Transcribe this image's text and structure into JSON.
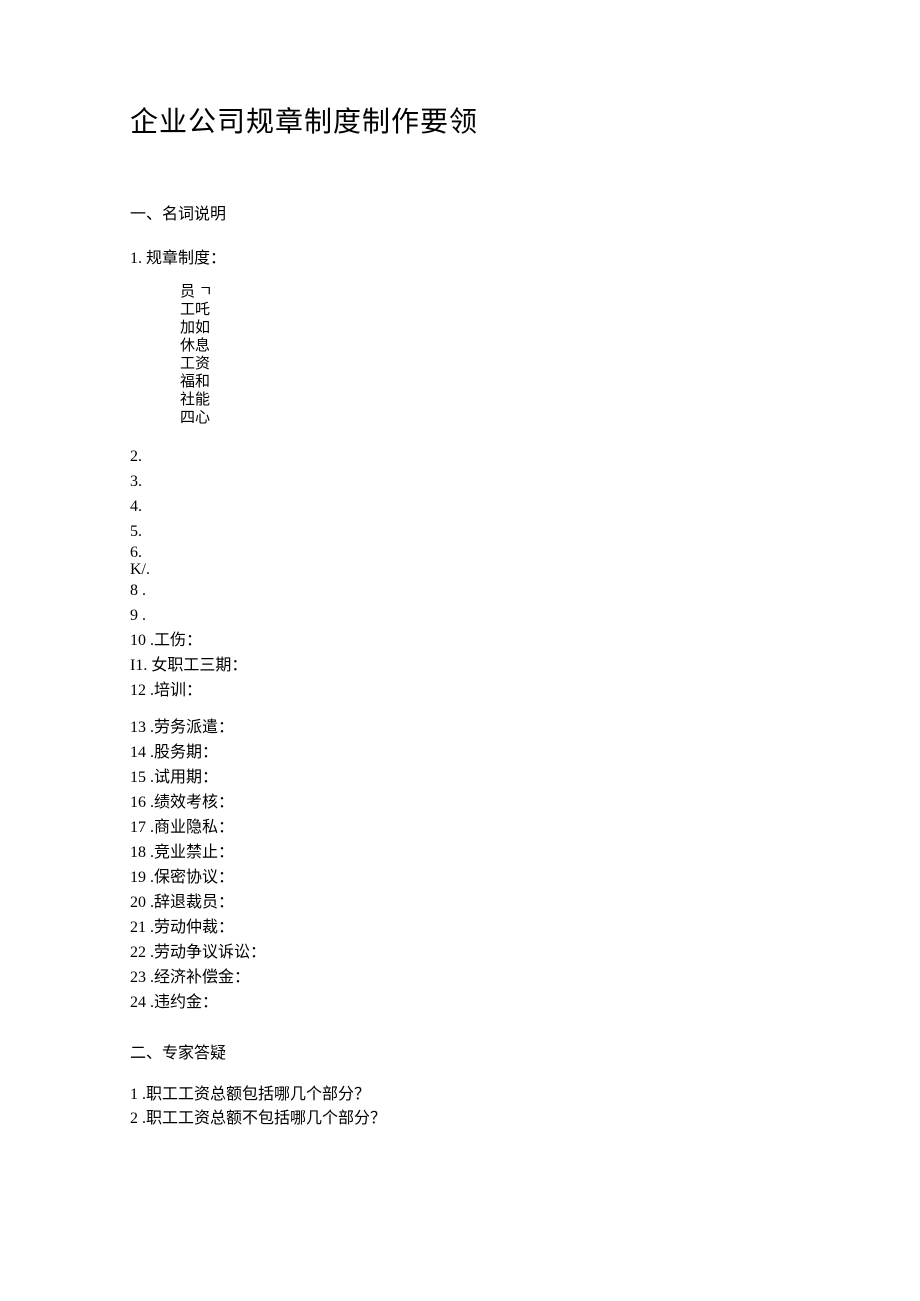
{
  "title": "企业公司规章制度制作要领",
  "section1_header": "一、名词说明",
  "item1": {
    "num": "1.",
    "label": "规章制度："
  },
  "vertical_lines": [
    "员 ㄱ",
    "工吒",
    "加如",
    "休息",
    "工资",
    "福和",
    "社能",
    "四心"
  ],
  "rows_A": [
    {
      "num": "2.",
      "label": ""
    },
    {
      "num": "3.",
      "label": ""
    },
    {
      "num": "4.",
      "label": ""
    },
    {
      "num": "5.",
      "label": ""
    }
  ],
  "row_67a": {
    "num": "6.",
    "label": ""
  },
  "row_67b": {
    "num": "K/.",
    "label": ""
  },
  "rows_B": [
    {
      "num": "8",
      "label": "."
    },
    {
      "num": "9",
      "label": "."
    },
    {
      "num": "10",
      "label": ".工伤："
    },
    {
      "num": "I1.",
      "label": "女职工三期："
    },
    {
      "num": "12",
      "label": ".培训："
    }
  ],
  "rows_C": [
    {
      "num": "13",
      "label": ".劳务派遣："
    },
    {
      "num": "14",
      "label": ".股务期："
    },
    {
      "num": "15",
      "label": ".试用期："
    },
    {
      "num": "16",
      "label": ".绩效考核："
    },
    {
      "num": "17",
      "label": ".商业隐私："
    },
    {
      "num": "18",
      "label": ".竞业禁止："
    },
    {
      "num": "19",
      "label": ".保密协议："
    },
    {
      "num": "20",
      "label": ".辞退裁员："
    },
    {
      "num": "21",
      "label": ".劳动仲裁："
    },
    {
      "num": "22",
      "label": ".劳动争议诉讼："
    },
    {
      "num": "23",
      "label": ".经济补偿金："
    },
    {
      "num": "24",
      "label": ".违约金："
    }
  ],
  "section2_header": "二、专家答疑",
  "questions": [
    {
      "num": "1",
      "label": ".职工工资总额包括哪几个部分？"
    },
    {
      "num": "2",
      "label": ".职工工资总额不包括哪几个部分？"
    }
  ]
}
